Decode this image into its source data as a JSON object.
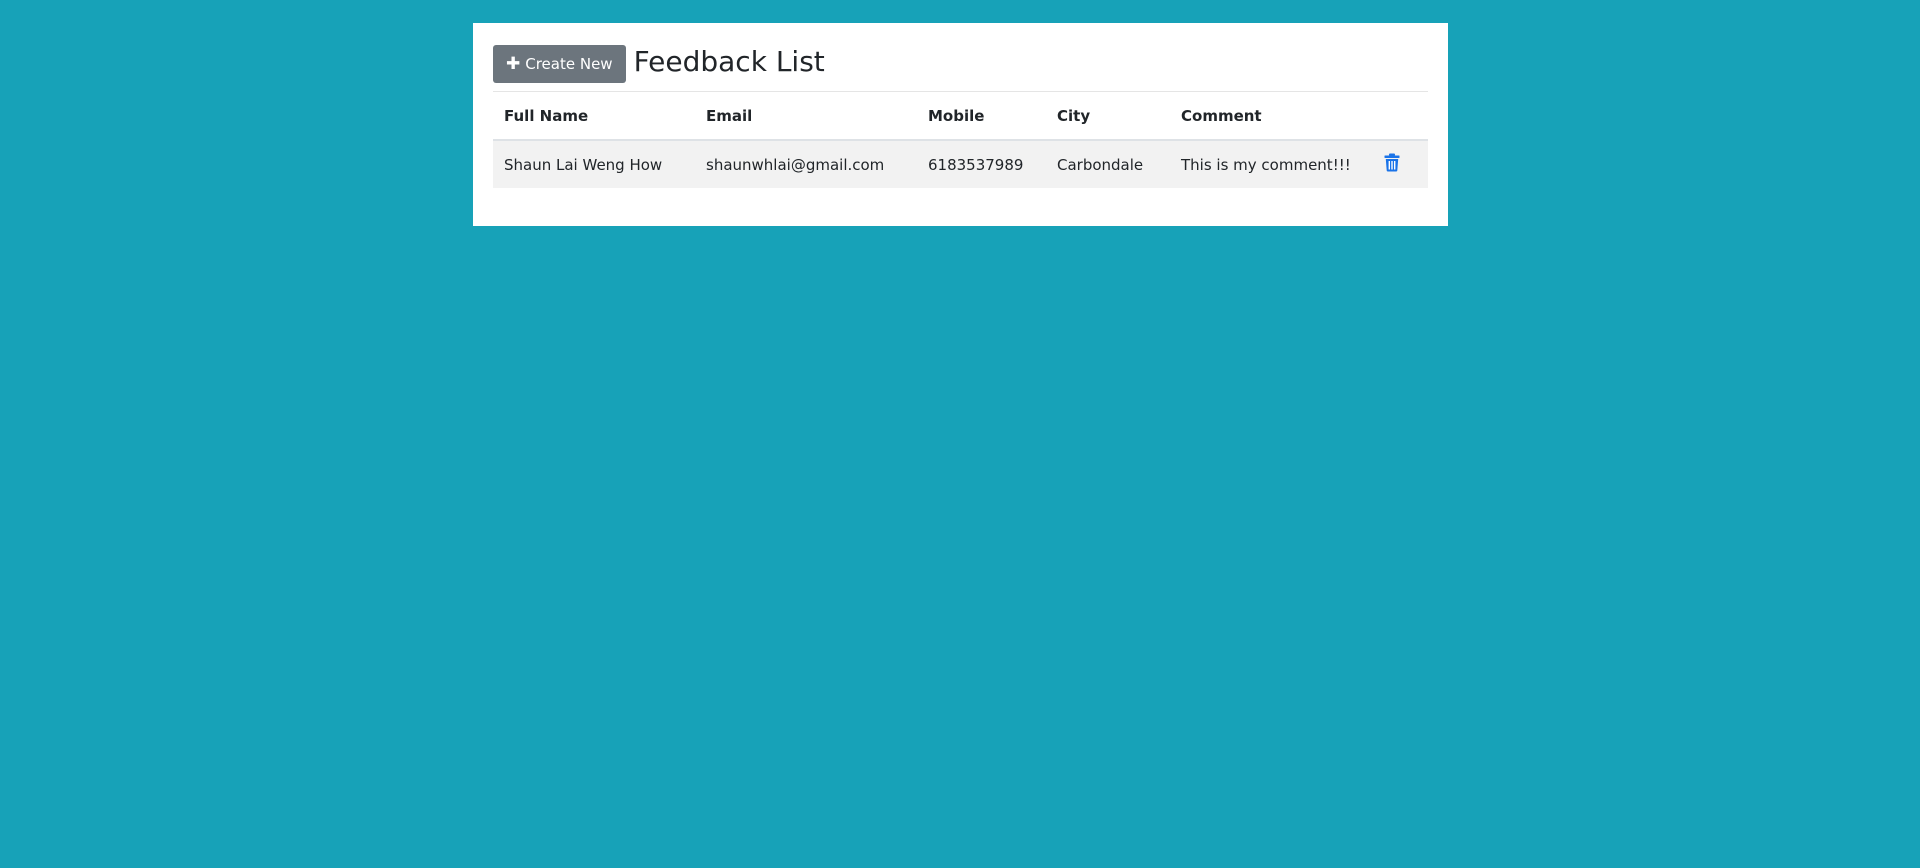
{
  "colors": {
    "background": "#17a2b8",
    "button": "#6c757d",
    "delete_icon": "#1a73e8"
  },
  "header": {
    "create_button_label": "Create New",
    "create_button_icon": "plus-icon",
    "title": "Feedback List"
  },
  "table": {
    "columns": [
      "Full Name",
      "Email",
      "Mobile",
      "City",
      "Comment"
    ],
    "rows": [
      {
        "full_name": "Shaun Lai Weng How",
        "email": "shaunwhlai@gmail.com",
        "mobile": "6183537989",
        "city": "Carbondale",
        "comment": "This is my comment!!!",
        "action_icon": "trash-icon"
      }
    ]
  }
}
